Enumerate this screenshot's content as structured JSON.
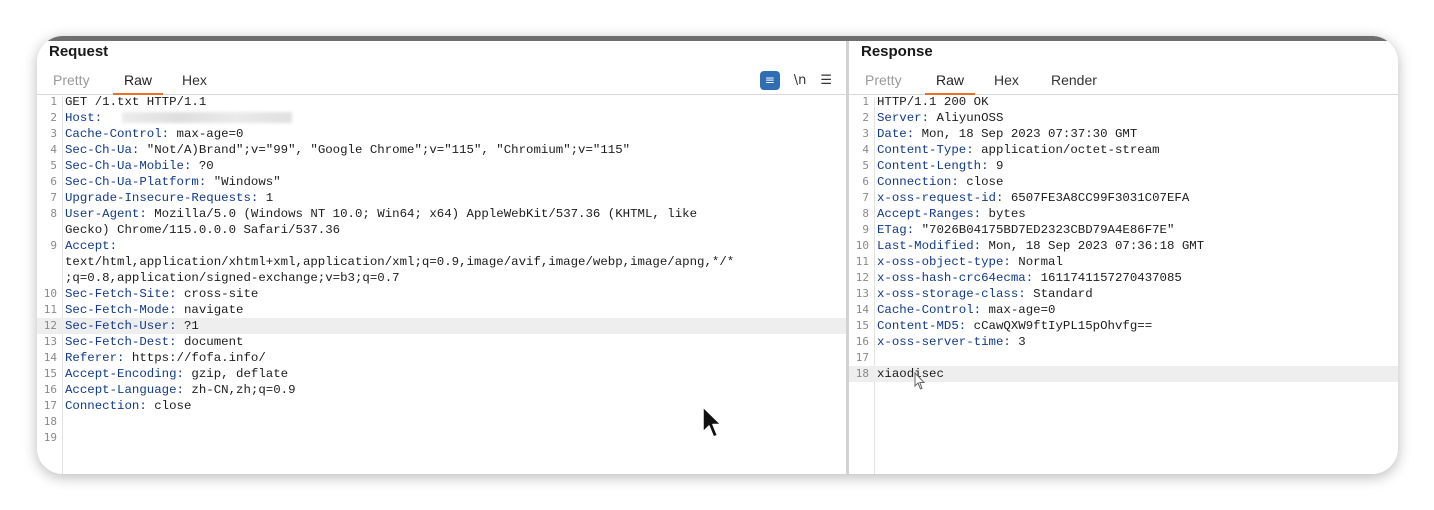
{
  "request": {
    "title": "Request",
    "tabs": [
      "Pretty",
      "Raw",
      "Hex"
    ],
    "tools": {
      "wrap_icon": "wrap-lines-icon",
      "newline_label": "\\n",
      "menu_icon": "hamburger-menu-icon"
    },
    "lines": [
      {
        "n": "1",
        "key": "",
        "val": "GET /1.txt HTTP/1.1"
      },
      {
        "n": "2",
        "key": "Host:",
        "val": ""
      },
      {
        "n": "3",
        "key": "Cache-Control:",
        "val": " max-age=0"
      },
      {
        "n": "4",
        "key": "Sec-Ch-Ua:",
        "val": " \"Not/A)Brand\";v=\"99\", \"Google Chrome\";v=\"115\", \"Chromium\";v=\"115\""
      },
      {
        "n": "5",
        "key": "Sec-Ch-Ua-Mobile:",
        "val": " ?0"
      },
      {
        "n": "6",
        "key": "Sec-Ch-Ua-Platform:",
        "val": " \"Windows\""
      },
      {
        "n": "7",
        "key": "Upgrade-Insecure-Requests:",
        "val": " 1"
      },
      {
        "n": "8",
        "key": "User-Agent:",
        "val": " Mozilla/5.0 (Windows NT 10.0; Win64; x64) AppleWebKit/537.36 (KHTML, like"
      },
      {
        "n": "",
        "key": "",
        "val": "Gecko) Chrome/115.0.0.0 Safari/537.36"
      },
      {
        "n": "9",
        "key": "Accept:",
        "val": ""
      },
      {
        "n": "",
        "key": "",
        "val": "text/html,application/xhtml+xml,application/xml;q=0.9,image/avif,image/webp,image/apng,*/*"
      },
      {
        "n": "",
        "key": "",
        "val": ";q=0.8,application/signed-exchange;v=b3;q=0.7"
      },
      {
        "n": "10",
        "key": "Sec-Fetch-Site:",
        "val": " cross-site"
      },
      {
        "n": "11",
        "key": "Sec-Fetch-Mode:",
        "val": " navigate"
      },
      {
        "n": "12",
        "key": "Sec-Fetch-User:",
        "val": " ?1"
      },
      {
        "n": "13",
        "key": "Sec-Fetch-Dest:",
        "val": " document"
      },
      {
        "n": "14",
        "key": "Referer:",
        "val": " https://fofa.info/"
      },
      {
        "n": "15",
        "key": "Accept-Encoding:",
        "val": " gzip, deflate"
      },
      {
        "n": "16",
        "key": "Accept-Language:",
        "val": " zh-CN,zh;q=0.9"
      },
      {
        "n": "17",
        "key": "Connection:",
        "val": " close"
      },
      {
        "n": "18",
        "key": "",
        "val": ""
      },
      {
        "n": "19",
        "key": "",
        "val": ""
      }
    ]
  },
  "response": {
    "title": "Response",
    "tabs": [
      "Pretty",
      "Raw",
      "Hex",
      "Render"
    ],
    "lines": [
      {
        "n": "1",
        "key": "",
        "val": "HTTP/1.1 200 OK"
      },
      {
        "n": "2",
        "key": "Server:",
        "val": " AliyunOSS"
      },
      {
        "n": "3",
        "key": "Date:",
        "val": " Mon, 18 Sep 2023 07:37:30 GMT"
      },
      {
        "n": "4",
        "key": "Content-Type:",
        "val": " application/octet-stream"
      },
      {
        "n": "5",
        "key": "Content-Length:",
        "val": " 9"
      },
      {
        "n": "6",
        "key": "Connection:",
        "val": " close"
      },
      {
        "n": "7",
        "key": "x-oss-request-id:",
        "val": " 6507FE3A8CC99F3031C07EFA"
      },
      {
        "n": "8",
        "key": "Accept-Ranges:",
        "val": " bytes"
      },
      {
        "n": "9",
        "key": "ETag:",
        "val": " \"7026B04175BD7ED2323CBD79A4E86F7E\""
      },
      {
        "n": "10",
        "key": "Last-Modified:",
        "val": " Mon, 18 Sep 2023 07:36:18 GMT"
      },
      {
        "n": "11",
        "key": "x-oss-object-type:",
        "val": " Normal"
      },
      {
        "n": "12",
        "key": "x-oss-hash-crc64ecma:",
        "val": " 1611741157270437085"
      },
      {
        "n": "13",
        "key": "x-oss-storage-class:",
        "val": " Standard"
      },
      {
        "n": "14",
        "key": "Cache-Control:",
        "val": " max-age=0"
      },
      {
        "n": "15",
        "key": "Content-MD5:",
        "val": " cCawQXW9ftIyPL15pOhvfg=="
      },
      {
        "n": "16",
        "key": "x-oss-server-time:",
        "val": " 3"
      },
      {
        "n": "17",
        "key": "",
        "val": ""
      },
      {
        "n": "18",
        "key": "",
        "val": "xiaodisec"
      }
    ]
  },
  "colors": {
    "accent": "#e8702a",
    "header_key": "#123a8a",
    "wrap_button": "#2f6db5",
    "highlight_row": "#eeeeee"
  },
  "pointer": {
    "icon": "mouse-pointer-icon"
  },
  "text_cursor": {
    "icon": "text-cursor-icon"
  }
}
